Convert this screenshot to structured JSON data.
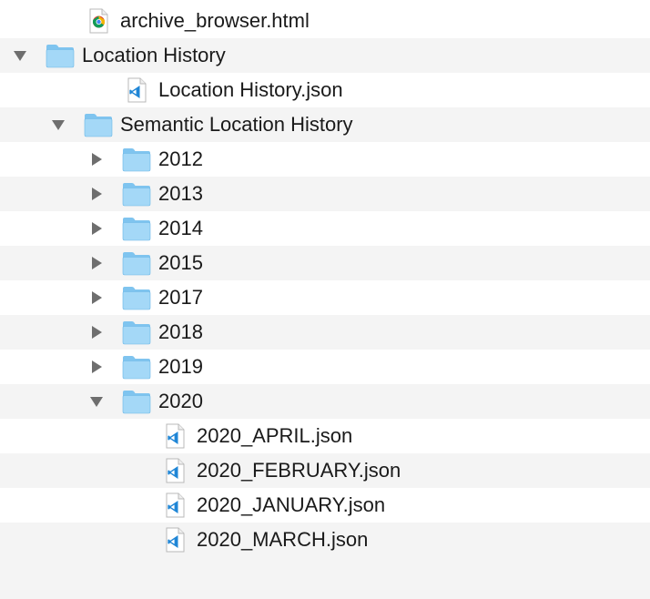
{
  "tree": [
    {
      "label": "archive_browser.html",
      "type": "chrome-file",
      "depth": 1,
      "disclosure": "none",
      "icon": "chrome-file-icon"
    },
    {
      "label": "Location History",
      "type": "folder",
      "depth": 0,
      "disclosure": "expanded",
      "icon": "folder-icon"
    },
    {
      "label": "Location History.json",
      "type": "vscode-file",
      "depth": 2,
      "disclosure": "none",
      "icon": "vscode-file-icon"
    },
    {
      "label": "Semantic Location History",
      "type": "folder",
      "depth": 1,
      "disclosure": "expanded",
      "icon": "folder-icon"
    },
    {
      "label": "2012",
      "type": "folder",
      "depth": 2,
      "disclosure": "collapsed",
      "icon": "folder-icon"
    },
    {
      "label": "2013",
      "type": "folder",
      "depth": 2,
      "disclosure": "collapsed",
      "icon": "folder-icon"
    },
    {
      "label": "2014",
      "type": "folder",
      "depth": 2,
      "disclosure": "collapsed",
      "icon": "folder-icon"
    },
    {
      "label": "2015",
      "type": "folder",
      "depth": 2,
      "disclosure": "collapsed",
      "icon": "folder-icon"
    },
    {
      "label": "2017",
      "type": "folder",
      "depth": 2,
      "disclosure": "collapsed",
      "icon": "folder-icon"
    },
    {
      "label": "2018",
      "type": "folder",
      "depth": 2,
      "disclosure": "collapsed",
      "icon": "folder-icon"
    },
    {
      "label": "2019",
      "type": "folder",
      "depth": 2,
      "disclosure": "collapsed",
      "icon": "folder-icon"
    },
    {
      "label": "2020",
      "type": "folder",
      "depth": 2,
      "disclosure": "expanded",
      "icon": "folder-icon"
    },
    {
      "label": "2020_APRIL.json",
      "type": "vscode-file",
      "depth": 3,
      "disclosure": "none",
      "icon": "vscode-file-icon"
    },
    {
      "label": "2020_FEBRUARY.json",
      "type": "vscode-file",
      "depth": 3,
      "disclosure": "none",
      "icon": "vscode-file-icon"
    },
    {
      "label": "2020_JANUARY.json",
      "type": "vscode-file",
      "depth": 3,
      "disclosure": "none",
      "icon": "vscode-file-icon"
    },
    {
      "label": "2020_MARCH.json",
      "type": "vscode-file",
      "depth": 3,
      "disclosure": "none",
      "icon": "vscode-file-icon"
    }
  ],
  "colors": {
    "folder_back": "#7fc4ef",
    "folder_front": "#a4d8f7",
    "folder_edge": "#6ab6e6",
    "disclosure": "#6e6e6e",
    "vscode_blue": "#1f86d6",
    "stripe": "#f4f4f4"
  }
}
